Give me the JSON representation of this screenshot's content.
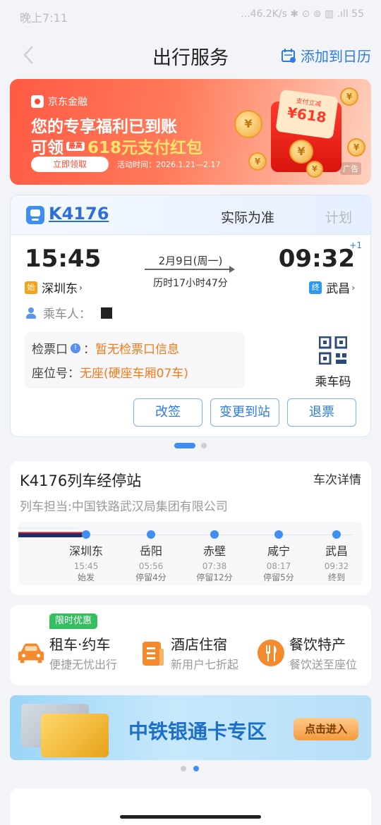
{
  "status_bar": {
    "time": "晚上7:11",
    "right": "...46.2K/s ✱ ⊙ ⊚ ▥ .ıll 55"
  },
  "nav": {
    "title": "出行服务",
    "add_calendar": "添加到日历"
  },
  "ad": {
    "brand": "京东金融",
    "line1": "您的专享福利已到账",
    "line2_prefix": "可领",
    "line2_tag": "最高",
    "line2_highlight": "618元支付红包",
    "cta": "立即领取",
    "period": "活动时间：2026.1.21—2.17",
    "ad_label": "广告",
    "card_title": "支付立减",
    "card_amount": "¥618"
  },
  "ticket": {
    "train_no": "K4176",
    "tab_actual": "实际为准",
    "tab_plan": "计划",
    "dep_time": "15:45",
    "arr_time": "09:32",
    "plus_days": "+1",
    "date": "2月9日(周一)",
    "duration": "历时17小时47分",
    "dep_badge": "始",
    "dep_station": "深圳东",
    "arr_badge": "终",
    "arr_station": "武昌",
    "passenger_label": "乘车人：",
    "passenger_name": "",
    "gate_label": "检票口",
    "gate_value": "暂无检票口信息",
    "seat_label": "座位号：",
    "seat_value": "无座(硬座车厢07车)",
    "qr_label": "乘车码",
    "buttons": [
      "改签",
      "变更到站",
      "退票"
    ]
  },
  "stops": {
    "title": "K4176列车经停站",
    "detail": "车次详情",
    "operator": "列车担当:中国铁路武汉局集团有限公司",
    "list": [
      {
        "name": "深圳东",
        "time": "15:45",
        "note": "始发"
      },
      {
        "name": "岳阳",
        "time": "05:56",
        "note": "停留4分"
      },
      {
        "name": "赤壁",
        "time": "07:38",
        "note": "停留12分"
      },
      {
        "name": "咸宁",
        "time": "08:17",
        "note": "停留5分"
      },
      {
        "name": "武昌",
        "time": "09:32",
        "note": "终到"
      }
    ]
  },
  "services": {
    "tag": "限时优惠",
    "items": [
      {
        "title": "租车·约车",
        "sub": "便捷无忧出行",
        "icon": "car-icon"
      },
      {
        "title": "酒店住宿",
        "sub": "新用户七折起",
        "icon": "hotel-icon"
      },
      {
        "title": "餐饮特产",
        "sub": "餐饮送至座位",
        "icon": "dining-icon"
      }
    ]
  },
  "bank_banner": {
    "text": "中铁银通卡专区",
    "cta": "点击进入"
  },
  "colors": {
    "accent": "#2c7be5",
    "warning": "#f07b1a",
    "promo_red": "#ff5a43"
  }
}
